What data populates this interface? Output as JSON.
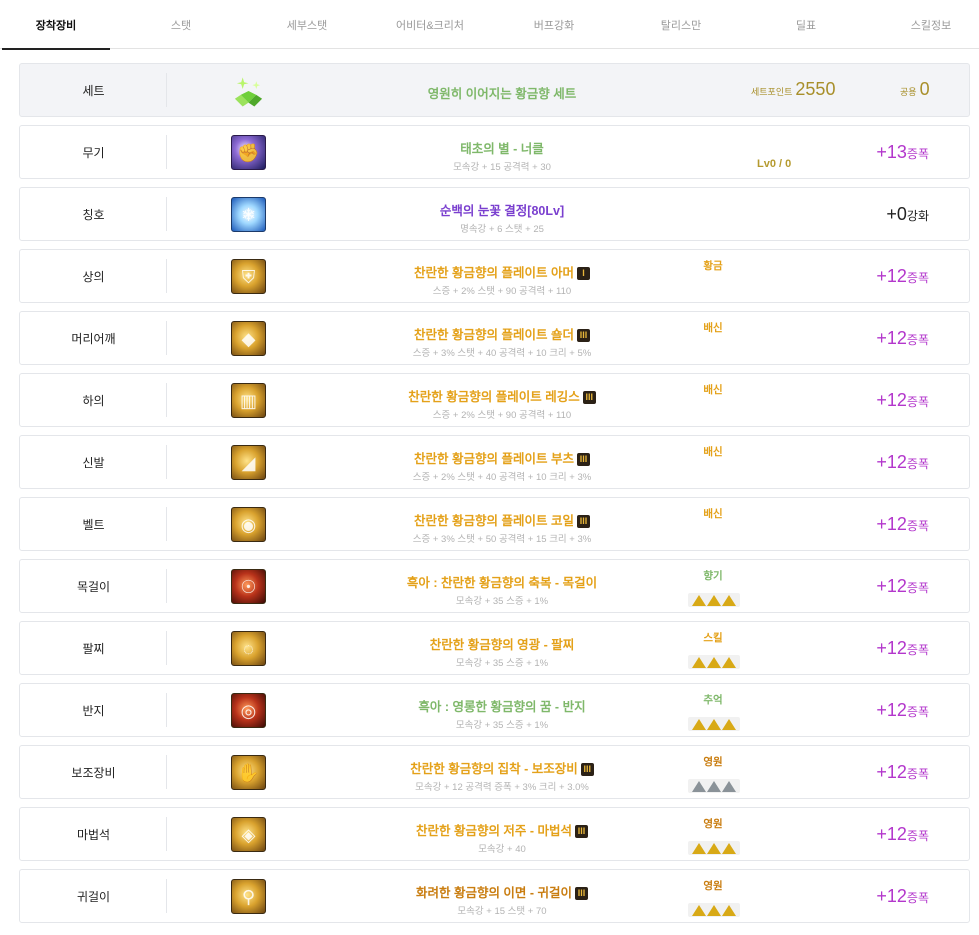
{
  "tabs": [
    "장착장비",
    "스탯",
    "세부스탯",
    "어비터&크리처",
    "버프강화",
    "탈리스만",
    "딜표",
    "스킬정보"
  ],
  "active_tab": 0,
  "set": {
    "slot": "세트",
    "name": "영원히 이어지는 황금향 세트",
    "point_label": "세트포인트",
    "point_value": "2550",
    "share_label": "공용",
    "share_value": "0",
    "icon": "sparkle-set-icon"
  },
  "items": [
    {
      "slot": "무기",
      "name": "태초의 별 - 너클",
      "name_color": "green",
      "stats": "모속강 + 15 공격력 + 30",
      "badge": "",
      "extra": "",
      "extra_color": "",
      "tris": "",
      "level": "Lv0 / 0",
      "enhance": "+13",
      "enhance_type": "증폭",
      "icon": "weapon-knuckle-icon"
    },
    {
      "slot": "칭호",
      "name": "순백의 눈꽃 결정[80Lv]",
      "name_color": "purple",
      "stats": "명속강 + 6 스탯 + 25",
      "badge": "",
      "extra": "",
      "extra_color": "",
      "tris": "",
      "level": "",
      "enhance": "+0",
      "enhance_type": "강화",
      "icon": "snowflake-title-icon"
    },
    {
      "slot": "상의",
      "name": "찬란한 황금향의 플레이트 아머",
      "name_color": "gold",
      "stats": "스증 + 2% 스탯 + 90 공격력 + 110",
      "badge": "I",
      "extra": "황금",
      "extra_color": "gold",
      "tris": "",
      "level": "",
      "enhance": "+12",
      "enhance_type": "증폭",
      "icon": "plate-armor-icon"
    },
    {
      "slot": "머리어깨",
      "name": "찬란한 황금향의 플레이트 숄더",
      "name_color": "gold",
      "stats": "스증 + 3% 스탯 + 40 공격력 + 10 크리 + 5%",
      "badge": "III",
      "extra": "배신",
      "extra_color": "gold",
      "tris": "",
      "level": "",
      "enhance": "+12",
      "enhance_type": "증폭",
      "icon": "plate-shoulder-icon"
    },
    {
      "slot": "하의",
      "name": "찬란한 황금향의 플레이트 레깅스",
      "name_color": "gold",
      "stats": "스증 + 2% 스탯 + 90 공격력 + 110",
      "badge": "III",
      "extra": "배신",
      "extra_color": "gold",
      "tris": "",
      "level": "",
      "enhance": "+12",
      "enhance_type": "증폭",
      "icon": "plate-leggings-icon"
    },
    {
      "slot": "신발",
      "name": "찬란한 황금향의 플레이트 부츠",
      "name_color": "gold",
      "stats": "스증 + 2% 스탯 + 40 공격력 + 10 크리 + 3%",
      "badge": "III",
      "extra": "배신",
      "extra_color": "gold",
      "tris": "",
      "level": "",
      "enhance": "+12",
      "enhance_type": "증폭",
      "icon": "plate-boots-icon"
    },
    {
      "slot": "벨트",
      "name": "찬란한 황금향의 플레이트 코일",
      "name_color": "gold",
      "stats": "스증 + 3% 스탯 + 50 공격력 + 15 크리 + 3%",
      "badge": "III",
      "extra": "배신",
      "extra_color": "gold",
      "tris": "",
      "level": "",
      "enhance": "+12",
      "enhance_type": "증폭",
      "icon": "plate-coil-icon"
    },
    {
      "slot": "목걸이",
      "name": "흑아 : 찬란한 황금향의 축복 - 목걸이",
      "name_color": "gold",
      "stats": "모속강 + 35 스증 + 1%",
      "badge": "",
      "extra": "향기",
      "extra_color": "green",
      "tris": "gold",
      "level": "",
      "enhance": "+12",
      "enhance_type": "증폭",
      "icon": "necklace-icon"
    },
    {
      "slot": "팔찌",
      "name": "찬란한 황금향의 영광 - 팔찌",
      "name_color": "gold",
      "stats": "모속강 + 35 스증 + 1%",
      "badge": "",
      "extra": "스킬",
      "extra_color": "gold",
      "tris": "gold",
      "level": "",
      "enhance": "+12",
      "enhance_type": "증폭",
      "icon": "bracelet-icon"
    },
    {
      "slot": "반지",
      "name": "흑아 : 영롱한 황금향의 꿈 - 반지",
      "name_color": "green",
      "stats": "모속강 + 35 스증 + 1%",
      "badge": "",
      "extra": "추억",
      "extra_color": "green",
      "tris": "gold",
      "level": "",
      "enhance": "+12",
      "enhance_type": "증폭",
      "icon": "ring-icon"
    },
    {
      "slot": "보조장비",
      "name": "찬란한 황금향의 집착 - 보조장비",
      "name_color": "gold",
      "stats": "모속강 + 12 공격력 증폭 + 3% 크리 + 3.0%",
      "badge": "III",
      "extra": "영원",
      "extra_color": "orange",
      "tris": "grey",
      "level": "",
      "enhance": "+12",
      "enhance_type": "증폭",
      "icon": "subweapon-icon"
    },
    {
      "slot": "마법석",
      "name": "찬란한 황금향의 저주 - 마법석",
      "name_color": "gold",
      "stats": "모속강 + 40",
      "badge": "III",
      "extra": "영원",
      "extra_color": "orange",
      "tris": "gold",
      "level": "",
      "enhance": "+12",
      "enhance_type": "증폭",
      "icon": "magic-stone-icon"
    },
    {
      "slot": "귀걸이",
      "name": "화려한 황금향의 이면 - 귀걸이",
      "name_color": "orange",
      "stats": "모속강 + 15 스탯 + 70",
      "badge": "III",
      "extra": "영원",
      "extra_color": "orange",
      "tris": "gold",
      "level": "",
      "enhance": "+12",
      "enhance_type": "증폭",
      "icon": "earring-icon"
    }
  ],
  "colors": {
    "gold": "#e4a119",
    "green": "#7fb86a",
    "purple": "#7a3fcf",
    "orange": "#c97d10",
    "enhance": "#b337cc",
    "setpoint": "#a88f2a"
  }
}
